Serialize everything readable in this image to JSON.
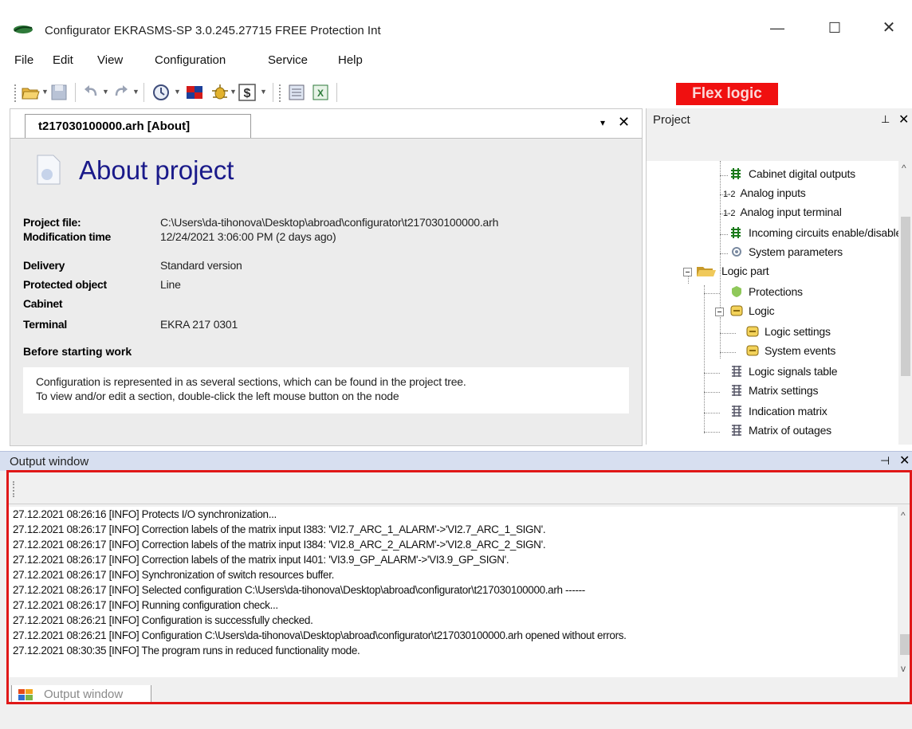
{
  "window": {
    "title": "Configurator EKRASMS-SP 3.0.245.27715 FREE Protection Int",
    "minimize": "—",
    "maximize": "☐",
    "close": "✕"
  },
  "menu": [
    "File",
    "Edit",
    "View",
    "Configuration",
    "Service",
    "Help"
  ],
  "toolbar": {
    "flex_logic_label": "Flex logic",
    "flex_logic_color": "#f01010"
  },
  "document": {
    "tab_label": "t217030100000.arh [About]",
    "tab_dropdown": "▾",
    "tab_close": "✕",
    "heading": "About project",
    "fields": [
      {
        "key": "Project file:",
        "value": "C:\\Users\\da-tihonova\\Desktop\\abroad\\configurator\\t217030100000.arh"
      },
      {
        "key": "Modification time",
        "value": "12/24/2021 3:06:00 PM (2 days ago)"
      },
      {
        "key": "Delivery",
        "value": "Standard version"
      },
      {
        "key": "Protected object",
        "value": "Line"
      },
      {
        "key": "Cabinet",
        "value": ""
      },
      {
        "key": "Terminal",
        "value": "EKRA 217 0301"
      }
    ],
    "before_title": "Before starting work",
    "hint_lines": [
      "Configuration is represented in as several sections, which can be found in the project tree.",
      "To view and/or edit a section, double-click the left mouse button on the node"
    ]
  },
  "project": {
    "title": "Project",
    "pin": "ᵖ",
    "close": "✕",
    "tree": [
      {
        "label": "Cabinet digital outputs",
        "icon": "digital-io-icon"
      },
      {
        "label": "Analog inputs",
        "icon": "analog-icon",
        "prefix": "1-2"
      },
      {
        "label": "Analog input terminal",
        "icon": "analog-icon",
        "prefix": "1-2"
      },
      {
        "label": "Incoming circuits enable/disable",
        "icon": "digital-io-icon"
      },
      {
        "label": "System parameters",
        "icon": "gear-icon"
      },
      {
        "label": "Logic part",
        "icon": "folder-open-icon"
      },
      {
        "label": "Protections",
        "icon": "shield-icon"
      },
      {
        "label": "Logic",
        "icon": "logic-icon"
      },
      {
        "label": "Logic settings",
        "icon": "logic-icon"
      },
      {
        "label": "System events",
        "icon": "logic-icon"
      },
      {
        "label": "Logic signals table",
        "icon": "matrix-icon"
      },
      {
        "label": "Matrix settings",
        "icon": "matrix-icon"
      },
      {
        "label": "Indication matrix",
        "icon": "matrix-icon"
      },
      {
        "label": "Matrix of outages",
        "icon": "matrix-icon"
      }
    ]
  },
  "output": {
    "title": "Output window",
    "pin": "⊣",
    "close": "✕",
    "tab_label": "Output window",
    "lines": [
      "27.12.2021 08:26:16 [INFO] Protects I/O synchronization...",
      "27.12.2021 08:26:17 [INFO] Correction labels of the matrix input I383: 'VI2.7_ARC_1_ALARM'->'VI2.7_ARC_1_SIGN'.",
      "27.12.2021 08:26:17 [INFO] Correction labels of the matrix input I384: 'VI2.8_ARC_2_ALARM'->'VI2.8_ARC_2_SIGN'.",
      "27.12.2021 08:26:17 [INFO] Correction labels of the matrix input I401: 'VI3.9_GP_ALARM'->'VI3.9_GP_SIGN'.",
      "27.12.2021 08:26:17 [INFO] Synchronization of switch resources buffer.",
      "27.12.2021 08:26:17 [INFO] Selected configuration C:\\Users\\da-tihonova\\Desktop\\abroad\\configurator\\t217030100000.arh ------",
      "27.12.2021 08:26:17 [INFO] Running configuration check...",
      "27.12.2021 08:26:21 [INFO] Configuration is successfully checked.",
      "27.12.2021 08:26:21 [INFO] Configuration C:\\Users\\da-tihonova\\Desktop\\abroad\\configurator\\t217030100000.arh opened without errors.",
      "27.12.2021 08:30:35 [INFO] The program runs in reduced functionality mode."
    ]
  },
  "colors": {
    "highlight": "#e01818",
    "heading": "#1a1a8a",
    "output_header": "#d7dff0"
  }
}
